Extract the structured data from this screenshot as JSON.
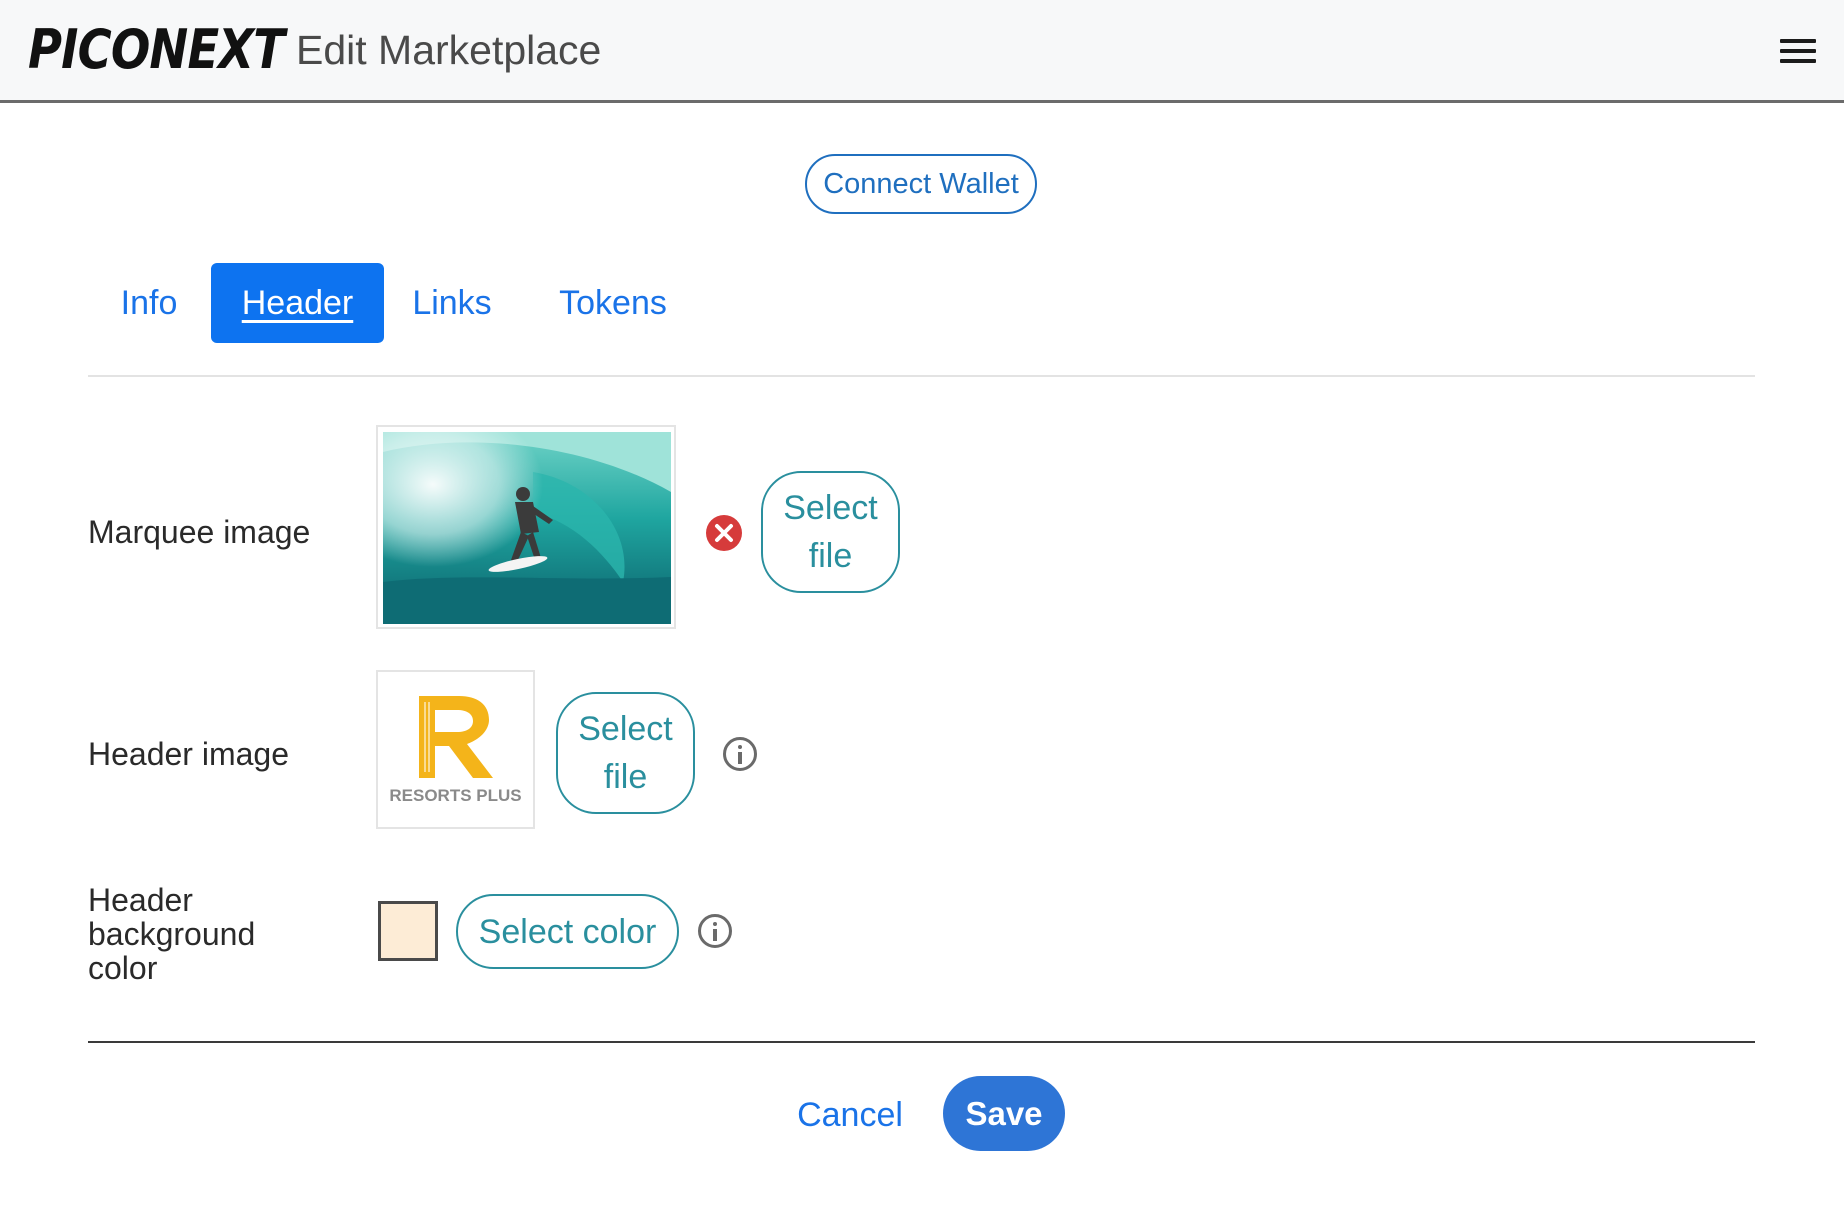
{
  "app": {
    "logo_text": "PICONEXT",
    "page_title": "Edit Marketplace",
    "menu_icon": "hamburger-menu-icon"
  },
  "wallet": {
    "connect_label": "Connect Wallet"
  },
  "tabs": [
    {
      "label": "Info",
      "active": false
    },
    {
      "label": "Header",
      "active": true
    },
    {
      "label": "Links",
      "active": false
    },
    {
      "label": "Tokens",
      "active": false
    }
  ],
  "form": {
    "marquee": {
      "label": "Marquee image",
      "select_label_line1": "Select",
      "select_label_line2": "file",
      "remove_icon": "remove-circle-icon"
    },
    "header_image": {
      "label": "Header image",
      "logo_letter": "R",
      "logo_caption": "RESORTS PLUS",
      "select_label_line1": "Select",
      "select_label_line2": "file",
      "info_icon": "info-icon"
    },
    "header_bg_color": {
      "label_line1": "Header",
      "label_line2": "background",
      "label_line3": "color",
      "swatch_color": "#fdecd6",
      "select_label": "Select color",
      "info_icon": "info-icon"
    }
  },
  "actions": {
    "cancel_label": "Cancel",
    "save_label": "Save"
  },
  "colors": {
    "accent_blue": "#1a73e8",
    "active_tab_bg": "#0d73f0",
    "teal_button": "#2a8f9e",
    "save_bg": "#2e75d6",
    "remove_red": "#d63b3b"
  }
}
